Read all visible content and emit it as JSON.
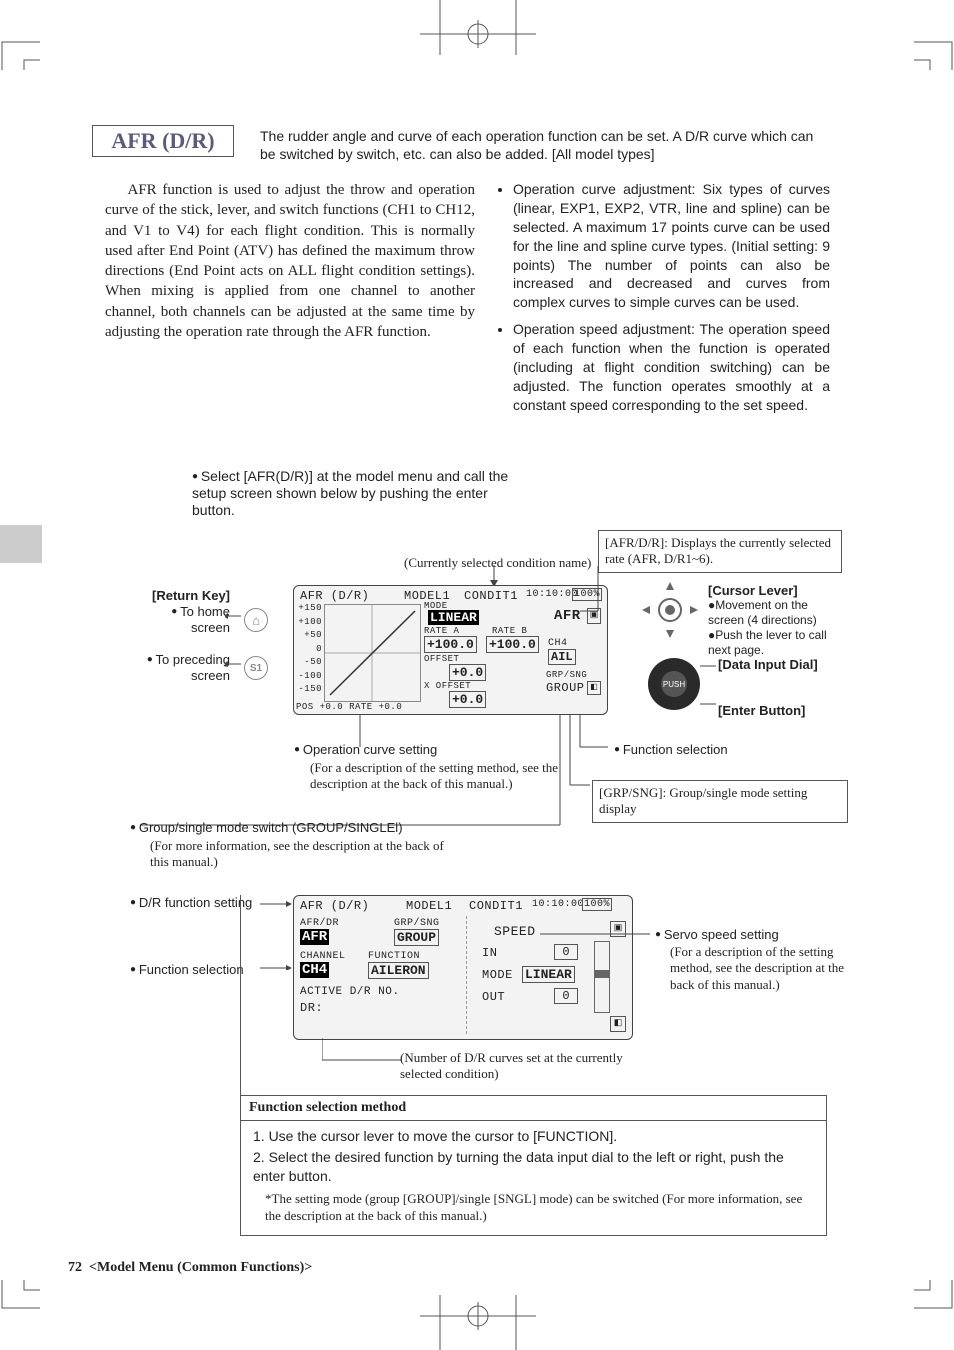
{
  "title": "AFR (D/R)",
  "intro": "The rudder angle and curve of each operation function can be set. A D/R curve which can be switched by switch, etc. can also be added. [All model types]",
  "para_left": "AFR function is used to adjust the throw and operation curve of the stick, lever, and switch functions (CH1 to CH12, and V1 to V4) for each flight condition. This is normally used after End Point (ATV) has defined the maximum throw directions (End Point acts on ALL flight condition settings). When mixing is applied from one channel to another channel, both channels can be adjusted at the same time by adjusting the operation rate through the AFR function.",
  "bullets": [
    "Operation curve adjustment: Six types of curves (linear, EXP1, EXP2, VTR, line and spline) can be selected. A maximum 17 points curve can be used for the line and spline curve types. (Initial setting: 9 points) The number of points can also be increased and decreased and curves from complex curves to simple curves can be used.",
    "Operation speed adjustment: The operation speed of each function when the function is operated (including at flight condition switching) can be adjusted. The function operates smoothly at a constant speed corresponding to the set speed."
  ],
  "instruction": "Select [AFR(D/R)] at the model menu and call the setup screen shown below by pushing the enter button.",
  "lcd1": {
    "header_left": "AFR (D/R)",
    "header_model": "MODEL1",
    "header_cond": "CONDIT1",
    "header_time": "10:10:00",
    "batt": "100%",
    "mode_label": "MODE",
    "mode_val": "LINEAR",
    "afr_label": "AFR",
    "rate_a": "RATE A",
    "rate_b": "RATE B",
    "rate_a_val": "+100.0",
    "rate_b_val": "+100.0",
    "offset_label": "OFFSET",
    "offset_val": "+0.0",
    "xoffset_label": "X OFFSET",
    "xoffset_val": "+0.0",
    "ch_label": "CH4",
    "ch_val": "AIL",
    "grp_label": "GRP/SNG",
    "grp_val": "GROUP",
    "yticks": [
      "+150",
      "+100",
      "+50",
      "0",
      "-50",
      "-100",
      "-150"
    ],
    "pos": "POS  +0.0 RATE  +0.0"
  },
  "lcd2": {
    "header_left": "AFR (D/R)",
    "header_model": "MODEL1",
    "header_cond": "CONDIT1",
    "header_time": "10:10:00",
    "batt": "100%",
    "afrdr_label": "AFR/DR",
    "afrdr_val": "AFR",
    "grp_label": "GRP/SNG",
    "grp_val": "GROUP",
    "channel_label": "CHANNEL",
    "function_label": "FUNCTION",
    "channel_val": "CH4",
    "function_val": "AILERON",
    "active_label": "ACTIVE D/R NO.",
    "dr_label": "DR:",
    "speed_label": "SPEED",
    "in_label": "IN",
    "in_val": "0",
    "mode_label": "MODE",
    "mode_val": "LINEAR",
    "out_label": "OUT",
    "out_val": "0"
  },
  "annots": {
    "cond_name": "(Currently selected condition name)",
    "afrdr_box1": "[AFR/D/R]: Displays the currently selected rate (AFR, D/R1~6).",
    "return_key": "[Return Key]",
    "to_home": "To home screen",
    "to_prec": "To preceding screen",
    "cursor_lever": "[Cursor Lever]",
    "cursor_bullets": "Movement on the screen (4 directions)\nPush the lever to call next page.",
    "data_dial": "[Data Input Dial]",
    "enter_btn": "[Enter Button]",
    "func_sel": "Function selection",
    "op_curve": "Operation curve setting",
    "op_curve_sub": "(For a description of the setting method, see the description at the back of this manual.)",
    "grpsng_box": "[GRP/SNG]: Group/single mode setting display",
    "grp_single": "Group/single mode switch (GROUP/SINGLEl)",
    "grp_single_sub": "(For more information, see the description at the back of this manual.)",
    "dr_func": "D/R function setting",
    "func_sel2": "Function selection",
    "servo_speed": "Servo speed setting",
    "servo_speed_sub": "(For a description of the setting method, see the description at the back of this manual.)",
    "dr_count": "(Number of D/R curves set at the currently selected condition)"
  },
  "proc": {
    "head": "Function selection method",
    "step1": "1. Use the cursor lever to move the cursor to [FUNCTION].",
    "step2": "2. Select the desired function by turning the data input dial to the left or right, push the enter button.",
    "note": "*The setting mode (group [GROUP]/single [SNGL] mode) can be switched (For more information, see the description at the back of this manual.)"
  },
  "footer": {
    "page": "72",
    "section": "<Model Menu (Common Functions)>"
  },
  "push_label": "PUSH"
}
